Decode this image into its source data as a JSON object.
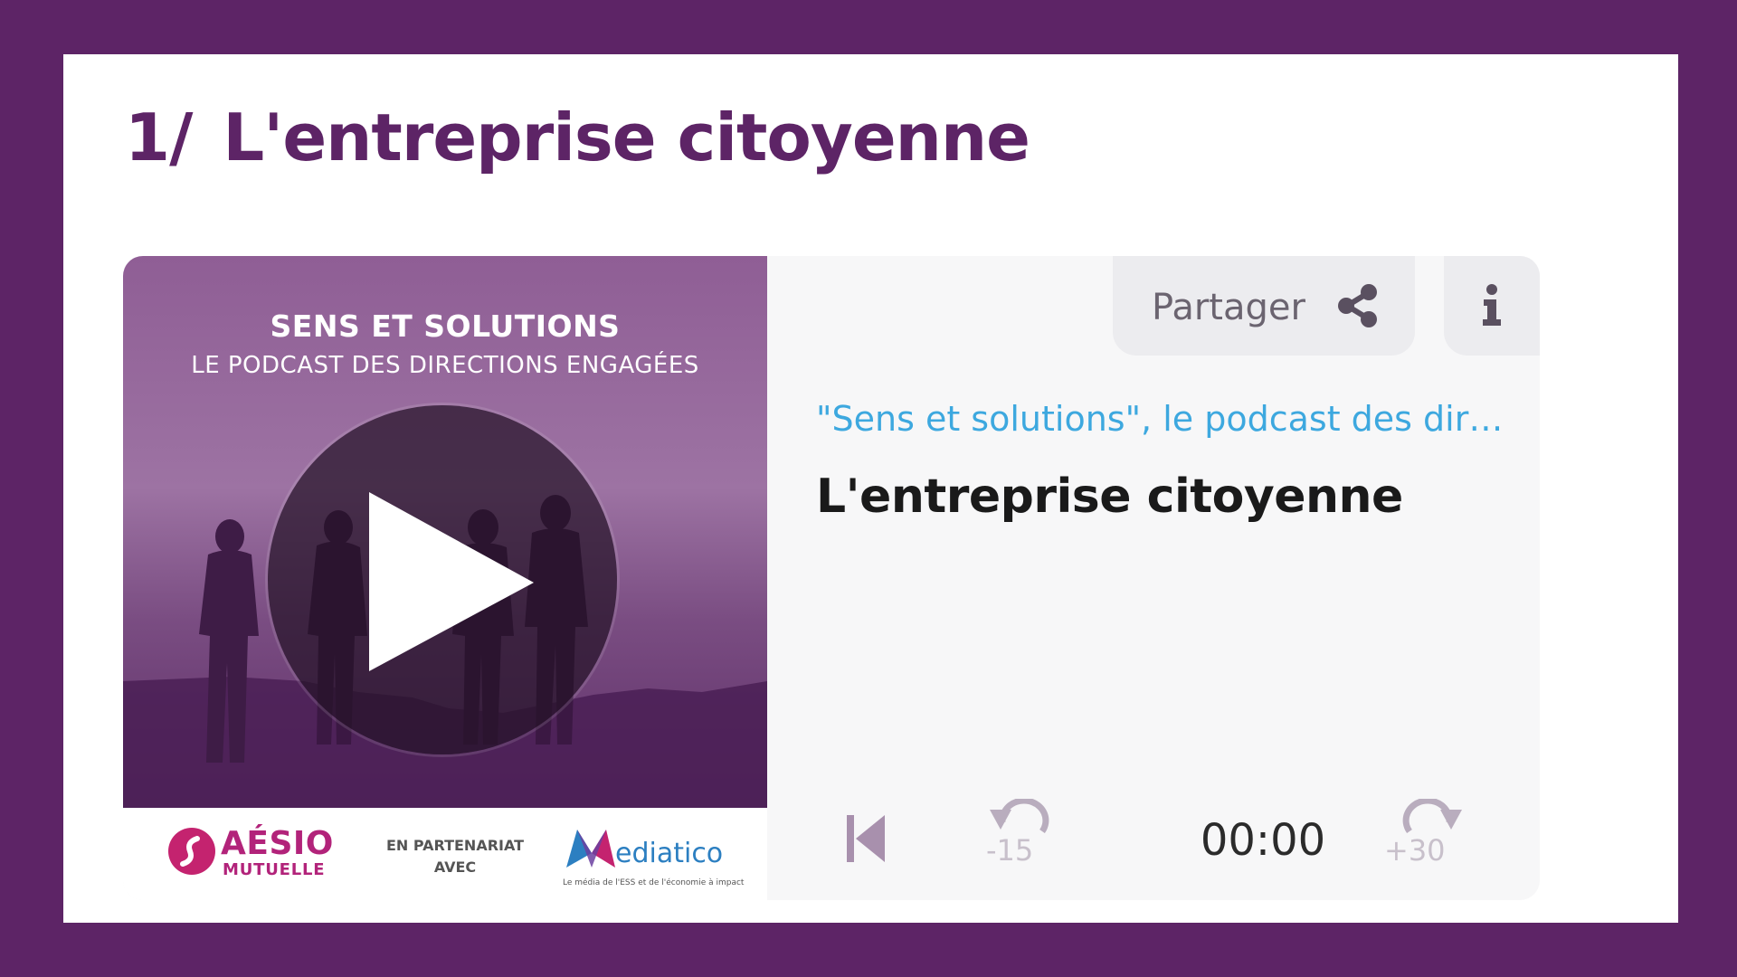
{
  "section": {
    "number": "1/",
    "title": "L'entreprise citoyenne"
  },
  "cover": {
    "title": "SENS ET SOLUTIONS",
    "subtitle": "LE PODCAST DES DIRECTIONS ENGAGÉES",
    "logos": {
      "aesio_name": "AÉSIO",
      "aesio_sub": "MUTUELLE",
      "partner_line1": "EN PARTENARIAT",
      "partner_line2": "AVEC",
      "mediatico_name": "ediatico",
      "mediatico_tagline": "Le média de l'ESS et de l'économie à impact"
    }
  },
  "player": {
    "share_label": "Partager",
    "series_title": "\"Sens et solutions\", le podcast des dir…",
    "episode_title": "L'entreprise citoyenne",
    "time": "00:00",
    "rewind_label": "-15",
    "forward_label": "+30"
  },
  "colors": {
    "frame": "#5d2466",
    "heading": "#5d2466",
    "series_link": "#3da8df",
    "brand_aesio": "#b2237a",
    "brand_mediatico": "#2c7fc1"
  },
  "icons": {
    "share": "share-icon",
    "info": "info-icon",
    "play": "play-icon",
    "previous": "skip-previous-icon",
    "rewind": "rewind-icon",
    "forward": "forward-icon"
  }
}
